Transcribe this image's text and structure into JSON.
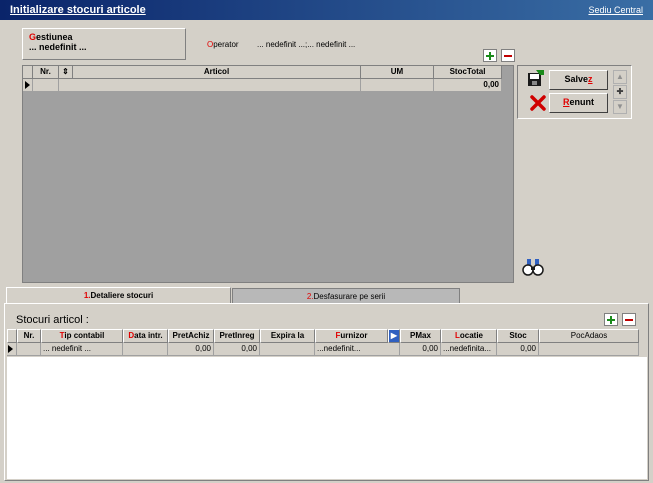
{
  "titlebar": {
    "title": "Initializare stocuri articole",
    "company": "Sediu Central"
  },
  "header": {
    "gestiune_accent": "G",
    "gestiune_rest": "estiunea",
    "gestiune_value": "... nedefinit ...",
    "operator_accent": "O",
    "operator_rest": "perator",
    "operator_value": "... nedefinit ...;... nedefinit ..."
  },
  "grid_articole": {
    "columns": [
      "Nr.",
      "Articol",
      "UM",
      "StocTotal"
    ],
    "rows": [
      {
        "nr": "",
        "articol": "",
        "um": "",
        "stoc_total": "0,00"
      }
    ]
  },
  "actions": {
    "save_accent": "Salve",
    "save_u": "z",
    "cancel_accent": "R",
    "cancel_rest": "enunt"
  },
  "tabs": [
    {
      "num": "1.",
      "label": "Detaliere stocuri"
    },
    {
      "num": "2.",
      "label": "Desfasurare pe serii"
    }
  ],
  "stocuri": {
    "title": "Stocuri articol :",
    "columns": [
      {
        "accent": "",
        "rest": "Nr."
      },
      {
        "accent": "T",
        "rest": "ip contabil"
      },
      {
        "accent": "D",
        "rest": "ata intr."
      },
      {
        "accent": "",
        "rest": "PretAchiz"
      },
      {
        "accent": "",
        "rest": "PretInreg"
      },
      {
        "accent": "",
        "rest": "Expira la"
      },
      {
        "accent": "F",
        "rest": "urnizor"
      },
      {
        "accent": "",
        "rest": "PMax"
      },
      {
        "accent": "L",
        "rest": "ocatie"
      },
      {
        "accent": "",
        "rest": "Stoc"
      },
      {
        "accent": "",
        "rest": "PocAdaos"
      }
    ],
    "row": {
      "nr": "",
      "tip": "... nedefinit ...",
      "data": "",
      "pret_achiz": "0,00",
      "pret_inreg": "0,00",
      "expira": "",
      "furnizor": "...nedefinit...",
      "pmax": "0,00",
      "locatie": "...nedefinita...",
      "stoc": "0,00",
      "poc": ""
    }
  },
  "colors": {
    "title_start": "#0a246a",
    "title_end": "#3a6ea5",
    "accent": "#e00000",
    "grid_bg": "#a0a0a0"
  }
}
